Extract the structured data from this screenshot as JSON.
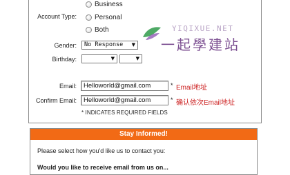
{
  "account_type": {
    "label": "Account Type:",
    "options": [
      "Business",
      "Personal",
      "Both"
    ]
  },
  "gender": {
    "label": "Gender:",
    "value": "No Response"
  },
  "birthday": {
    "label": "Birthday:"
  },
  "email": {
    "label": "Email:",
    "value": "Helloworld@gmail.com",
    "required_mark": "*",
    "annotation": "Email地址"
  },
  "confirm_email": {
    "label": "Confirm Email:",
    "value": "Helloworld@gmail.com",
    "required_mark": "*",
    "annotation": "确认依次Email地址"
  },
  "required_note": "* INDICATES REQUIRED FIELDS",
  "watermark": {
    "url": "YIQIXUE.NET",
    "text": "一起學建站"
  },
  "stay_informed": {
    "title": "Stay Informed!",
    "prompt": "Please select how you'd like us to contact you:",
    "question": "Would you like to receive email from us on..."
  },
  "colors": {
    "banner": "#f26a15",
    "annotation": "#cc1f1f",
    "watermark": "#6e3d86"
  }
}
